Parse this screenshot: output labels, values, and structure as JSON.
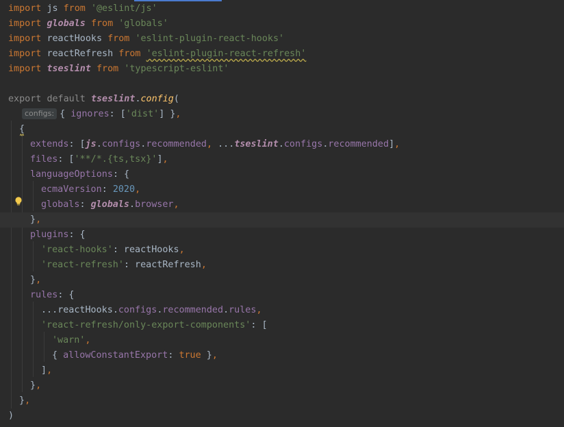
{
  "editor": {
    "lines": [
      {
        "tokens": [
          [
            "kw",
            "import"
          ],
          [
            "id",
            " "
          ],
          [
            "id",
            "js"
          ],
          [
            "id",
            " "
          ],
          [
            "kw",
            "from"
          ],
          [
            "id",
            " "
          ],
          [
            "str",
            "'@eslint/js'"
          ]
        ]
      },
      {
        "tokens": [
          [
            "kw",
            "import"
          ],
          [
            "id",
            " "
          ],
          [
            "obj",
            "globals"
          ],
          [
            "id",
            " "
          ],
          [
            "kw",
            "from"
          ],
          [
            "id",
            " "
          ],
          [
            "str",
            "'globals'"
          ]
        ]
      },
      {
        "tokens": [
          [
            "kw",
            "import"
          ],
          [
            "id",
            " "
          ],
          [
            "id",
            "reactHooks"
          ],
          [
            "id",
            " "
          ],
          [
            "kw",
            "from"
          ],
          [
            "id",
            " "
          ],
          [
            "str",
            "'eslint-plugin-react-hooks'"
          ]
        ]
      },
      {
        "tokens": [
          [
            "kw",
            "import"
          ],
          [
            "id",
            " "
          ],
          [
            "id",
            "reactRefresh"
          ],
          [
            "id",
            " "
          ],
          [
            "kw",
            "from"
          ],
          [
            "id",
            " "
          ],
          [
            "str squiggle",
            "'eslint-plugin-react-refresh'"
          ]
        ]
      },
      {
        "tokens": [
          [
            "kw",
            "import"
          ],
          [
            "id",
            " "
          ],
          [
            "obj",
            "tseslint"
          ],
          [
            "id",
            " "
          ],
          [
            "kw",
            "from"
          ],
          [
            "id",
            " "
          ],
          [
            "str",
            "'typescript-eslint'"
          ]
        ]
      },
      {
        "tokens": []
      },
      {
        "tokens": [
          [
            "kwl",
            "export"
          ],
          [
            "id",
            " "
          ],
          [
            "kwl",
            "default"
          ],
          [
            "id",
            " "
          ],
          [
            "obj",
            "tseslint"
          ],
          [
            "id",
            "."
          ],
          [
            "fn",
            "config"
          ],
          [
            "id",
            "("
          ]
        ]
      },
      {
        "hint": "configs:",
        "tokens": [
          [
            "id",
            "{ "
          ],
          [
            "prop",
            "ignores"
          ],
          [
            "id",
            ": ["
          ],
          [
            "str",
            "'dist'"
          ],
          [
            "id",
            "] }"
          ],
          [
            "kw",
            ","
          ]
        ]
      },
      {
        "tokens": [
          [
            "id",
            "{"
          ]
        ]
      },
      {
        "tokens": [
          [
            "prop",
            "extends"
          ],
          [
            "id",
            ": ["
          ],
          [
            "obj",
            "js"
          ],
          [
            "id",
            "."
          ],
          [
            "prop",
            "configs"
          ],
          [
            "id",
            "."
          ],
          [
            "prop",
            "recommended"
          ],
          [
            "kw",
            ","
          ],
          [
            "id",
            " ..."
          ],
          [
            "obj",
            "tseslint"
          ],
          [
            "id",
            "."
          ],
          [
            "prop",
            "configs"
          ],
          [
            "id",
            "."
          ],
          [
            "prop",
            "recommended"
          ],
          [
            "id",
            "]"
          ],
          [
            "kw",
            ","
          ]
        ]
      },
      {
        "tokens": [
          [
            "prop",
            "files"
          ],
          [
            "id",
            ": ["
          ],
          [
            "str",
            "'**/*.{ts,tsx}'"
          ],
          [
            "id",
            "]"
          ],
          [
            "kw",
            ","
          ]
        ]
      },
      {
        "tokens": [
          [
            "prop",
            "languageOptions"
          ],
          [
            "id",
            ": {"
          ]
        ]
      },
      {
        "tokens": [
          [
            "prop",
            "ecmaVersion"
          ],
          [
            "id",
            ": "
          ],
          [
            "num",
            "2020"
          ],
          [
            "kw",
            ","
          ]
        ]
      },
      {
        "tokens": [
          [
            "prop",
            "globals"
          ],
          [
            "id",
            ": "
          ],
          [
            "obj",
            "globals"
          ],
          [
            "id",
            "."
          ],
          [
            "prop",
            "browser"
          ],
          [
            "kw",
            ","
          ]
        ]
      },
      {
        "tokens": [
          [
            "id",
            "}"
          ],
          [
            "kw",
            ","
          ]
        ]
      },
      {
        "tokens": [
          [
            "prop",
            "plugins"
          ],
          [
            "id",
            ": {"
          ]
        ]
      },
      {
        "tokens": [
          [
            "str",
            "'react-hooks'"
          ],
          [
            "id",
            ": reactHooks"
          ],
          [
            "kw",
            ","
          ]
        ]
      },
      {
        "tokens": [
          [
            "str",
            "'react-refresh'"
          ],
          [
            "id",
            ": reactRefresh"
          ],
          [
            "kw",
            ","
          ]
        ]
      },
      {
        "tokens": [
          [
            "id",
            "}"
          ],
          [
            "kw",
            ","
          ]
        ]
      },
      {
        "tokens": [
          [
            "prop",
            "rules"
          ],
          [
            "id",
            ": {"
          ]
        ]
      },
      {
        "tokens": [
          [
            "id",
            "..."
          ],
          [
            "id",
            "reactHooks"
          ],
          [
            "id",
            "."
          ],
          [
            "prop",
            "configs"
          ],
          [
            "id",
            "."
          ],
          [
            "prop",
            "recommended"
          ],
          [
            "id",
            "."
          ],
          [
            "prop",
            "rules"
          ],
          [
            "kw",
            ","
          ]
        ]
      },
      {
        "tokens": [
          [
            "str",
            "'react-refresh/only-export-components'"
          ],
          [
            "id",
            ": ["
          ]
        ]
      },
      {
        "tokens": [
          [
            "str",
            "'warn'"
          ],
          [
            "kw",
            ","
          ]
        ]
      },
      {
        "tokens": [
          [
            "id",
            "{ "
          ],
          [
            "prop",
            "allowConstantExport"
          ],
          [
            "id",
            ": "
          ],
          [
            "kw",
            "true"
          ],
          [
            "id",
            " }"
          ],
          [
            "kw",
            ","
          ]
        ]
      },
      {
        "tokens": [
          [
            "id",
            "]"
          ],
          [
            "kw",
            ","
          ]
        ]
      },
      {
        "tokens": [
          [
            "id",
            "}"
          ],
          [
            "kw",
            ","
          ]
        ]
      },
      {
        "tokens": [
          [
            "id",
            "}"
          ],
          [
            "kw",
            ","
          ]
        ]
      },
      {
        "tokens": [
          [
            "id",
            ")"
          ]
        ]
      }
    ]
  },
  "icons": {
    "intention": "lightbulb-icon",
    "brace_marker": "fold-marker-icon"
  },
  "colors": {
    "background": "#2b2b2b",
    "current_line": "#323232",
    "keyword": "#cc7832",
    "string": "#6a8759",
    "number": "#6897bb",
    "property": "#9876aa",
    "identifier": "#a9b7c6",
    "function": "#ffc66d",
    "bulb": "#f2c94c"
  }
}
